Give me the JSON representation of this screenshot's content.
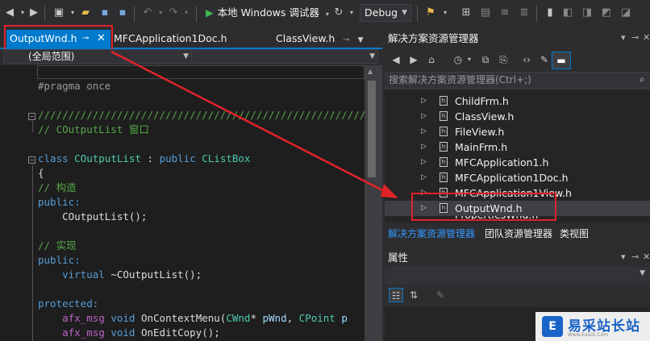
{
  "toolbar": {
    "run_label": "本地 Windows 调试器",
    "config": "Debug"
  },
  "editor_tabs": {
    "active": "OutputWnd.h",
    "second": "MFCApplication1Doc.h",
    "classview": "ClassView.h"
  },
  "scope": {
    "left": "(全局范围)",
    "right": ""
  },
  "code": {
    "lines": [
      "#pragma once",
      "",
      "////////////////////////////////////////////////////////////",
      "// COutputList 窗口",
      "",
      "class COutputList : public CListBox",
      "{",
      "// 构造",
      "public:",
      "    COutputList();",
      "",
      "// 实现",
      "public:",
      "    virtual ~COutputList();",
      "",
      "protected:",
      "    afx_msg void OnContextMenu(CWnd* pWnd, CPoint p",
      "    afx_msg void OnEditCopy();"
    ]
  },
  "solution_explorer": {
    "title": "解决方案资源管理器",
    "search_placeholder": "搜索解决方案资源管理器(Ctrl+;)",
    "items": [
      {
        "label": "ChildFrm.h"
      },
      {
        "label": "ClassView.h"
      },
      {
        "label": "FileView.h"
      },
      {
        "label": "MainFrm.h"
      },
      {
        "label": "MFCApplication1.h"
      },
      {
        "label": "MFCApplication1Doc.h"
      },
      {
        "label": "MFCApplication1View.h"
      },
      {
        "label": "OutputWnd.h"
      },
      {
        "label": "PropertiesWnd.h"
      }
    ],
    "tabs": [
      "解决方案资源管理器",
      "团队资源管理器",
      "类视图"
    ]
  },
  "properties": {
    "title": "属性"
  },
  "watermark": {
    "text": "易采站长站",
    "sub": "Www.Easck.Com"
  },
  "colors": {
    "accent": "#007acc",
    "highlight_box": "#e0232a",
    "arrow": "#e0232a"
  }
}
